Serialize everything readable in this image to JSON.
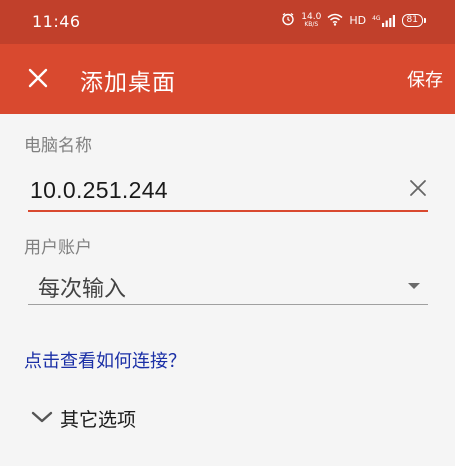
{
  "status_bar": {
    "time": "11:46",
    "net_speed_value": "14.0",
    "net_speed_unit": "KB/S",
    "hd_label": "HD",
    "network_type": "4G",
    "battery": "81"
  },
  "toolbar": {
    "title": "添加桌面",
    "save_label": "保存",
    "close_icon": "close-icon"
  },
  "form": {
    "pc_name_label": "电脑名称",
    "pc_name_value": "10.0.251.244",
    "user_account_label": "用户账户",
    "user_account_value": "每次输入"
  },
  "help_link": "点击查看如何连接？",
  "more_options": {
    "label": "其它选项",
    "icon": "chevron-down-icon"
  },
  "colors": {
    "status_bar_bg": "#c1402b",
    "toolbar_bg": "#d9492f",
    "accent": "#d9492f",
    "link": "#1a2fa6",
    "page_bg": "#f5f5f5"
  }
}
